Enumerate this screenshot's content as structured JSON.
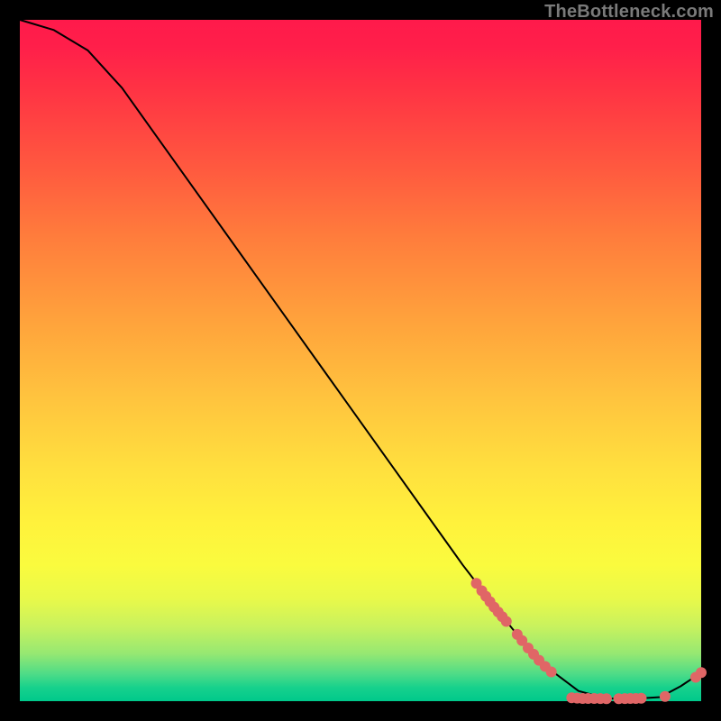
{
  "watermark": "TheBottleneck.com",
  "chart_data": {
    "type": "line",
    "title": "",
    "xlabel": "",
    "ylabel": "",
    "xlim": [
      0,
      100
    ],
    "ylim": [
      0,
      100
    ],
    "curve": [
      {
        "x": 0,
        "y": 100
      },
      {
        "x": 5,
        "y": 98.5
      },
      {
        "x": 10,
        "y": 95.5
      },
      {
        "x": 15,
        "y": 90
      },
      {
        "x": 20,
        "y": 83
      },
      {
        "x": 25,
        "y": 76
      },
      {
        "x": 30,
        "y": 69
      },
      {
        "x": 35,
        "y": 62
      },
      {
        "x": 40,
        "y": 55
      },
      {
        "x": 45,
        "y": 48
      },
      {
        "x": 50,
        "y": 41
      },
      {
        "x": 55,
        "y": 34
      },
      {
        "x": 60,
        "y": 27
      },
      {
        "x": 65,
        "y": 20
      },
      {
        "x": 70,
        "y": 13.5
      },
      {
        "x": 74,
        "y": 8.5
      },
      {
        "x": 78,
        "y": 4.5
      },
      {
        "x": 82,
        "y": 1.5
      },
      {
        "x": 86,
        "y": 0.4
      },
      {
        "x": 90,
        "y": 0.35
      },
      {
        "x": 94,
        "y": 0.6
      },
      {
        "x": 97,
        "y": 2.2
      },
      {
        "x": 100,
        "y": 4.2
      }
    ],
    "markers": [
      {
        "x": 67,
        "y": 17.3
      },
      {
        "x": 67.8,
        "y": 16.2
      },
      {
        "x": 68.4,
        "y": 15.4
      },
      {
        "x": 69,
        "y": 14.6
      },
      {
        "x": 69.6,
        "y": 13.8
      },
      {
        "x": 70.2,
        "y": 13.1
      },
      {
        "x": 70.8,
        "y": 12.4
      },
      {
        "x": 71.4,
        "y": 11.7
      },
      {
        "x": 73,
        "y": 9.8
      },
      {
        "x": 73.7,
        "y": 8.9
      },
      {
        "x": 74.6,
        "y": 7.8
      },
      {
        "x": 75.4,
        "y": 6.9
      },
      {
        "x": 76.2,
        "y": 6.0
      },
      {
        "x": 77.1,
        "y": 5.1
      },
      {
        "x": 78,
        "y": 4.3
      },
      {
        "x": 81,
        "y": 0.5
      },
      {
        "x": 81.8,
        "y": 0.45
      },
      {
        "x": 82.6,
        "y": 0.4
      },
      {
        "x": 83.4,
        "y": 0.4
      },
      {
        "x": 84.3,
        "y": 0.4
      },
      {
        "x": 85.2,
        "y": 0.38
      },
      {
        "x": 86.1,
        "y": 0.37
      },
      {
        "x": 87.9,
        "y": 0.36
      },
      {
        "x": 88.8,
        "y": 0.38
      },
      {
        "x": 89.6,
        "y": 0.39
      },
      {
        "x": 90.4,
        "y": 0.4
      },
      {
        "x": 91.2,
        "y": 0.43
      },
      {
        "x": 94.7,
        "y": 0.7
      },
      {
        "x": 99.2,
        "y": 3.5
      },
      {
        "x": 100,
        "y": 4.2
      }
    ],
    "marker_color": "#e06666",
    "curve_color": "#000000",
    "gradient_stops": [
      {
        "pos": 0,
        "color": "#ff1a4b"
      },
      {
        "pos": 50,
        "color": "#ffc53e"
      },
      {
        "pos": 80,
        "color": "#fafb3e"
      },
      {
        "pos": 100,
        "color": "#00c98b"
      }
    ]
  }
}
